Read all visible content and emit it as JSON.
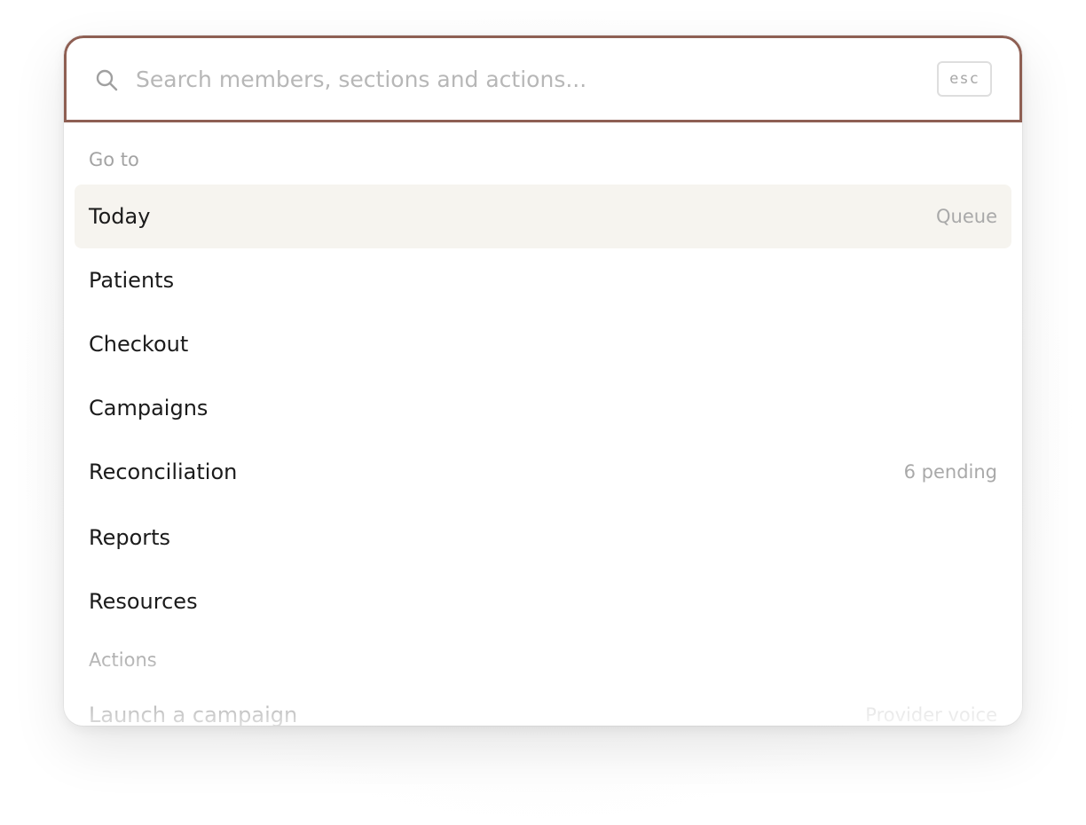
{
  "search": {
    "placeholder": "Search members, sections and actions...",
    "value": "",
    "esc_label": "esc"
  },
  "sections": {
    "goto_label": "Go to",
    "actions_label": "Actions"
  },
  "goto_items": [
    {
      "label": "Today",
      "hint": "Queue",
      "active": true
    },
    {
      "label": "Patients",
      "hint": ""
    },
    {
      "label": "Checkout",
      "hint": ""
    },
    {
      "label": "Campaigns",
      "hint": ""
    },
    {
      "label": "Reconciliation",
      "hint": "6 pending"
    },
    {
      "label": "Reports",
      "hint": ""
    },
    {
      "label": "Resources",
      "hint": ""
    }
  ],
  "action_items": [
    {
      "label": "Launch a campaign",
      "hint": "Provider voice"
    }
  ],
  "colors": {
    "accent_border": "#8e5f53",
    "active_row": "#f6f4ef"
  },
  "icons": {
    "search": "search-icon"
  }
}
